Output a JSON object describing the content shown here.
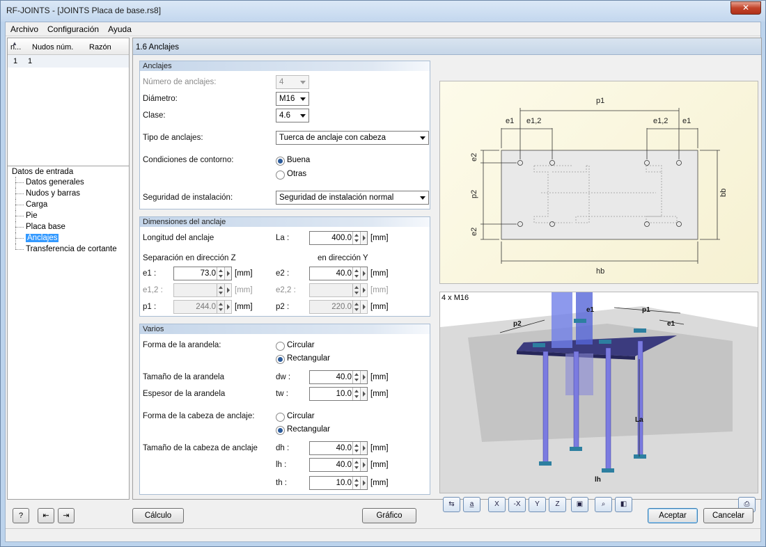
{
  "window": {
    "title": "RF-JOINTS - [JOINTS Placa de base.rs8]",
    "close_glyph": "✕"
  },
  "menu": [
    "Archivo",
    "Configuración",
    "Ayuda"
  ],
  "nav_table": {
    "headers": [
      "n...",
      "Nudos núm.",
      "Razón"
    ],
    "rows": [
      {
        "n": "1",
        "nudos": "1",
        "razon": ""
      }
    ]
  },
  "tree": {
    "root": "Datos de entrada",
    "items": [
      "Datos generales",
      "Nudos y barras",
      "Carga",
      "Pie",
      "Placa base",
      "Anclajes",
      "Transferencia de cortante"
    ],
    "selected": "Anclajes"
  },
  "main_title": "1.6 Anclajes",
  "anclajes": {
    "header": "Anclajes",
    "num_label": "Número de anclajes:",
    "num_value": "4",
    "diam_label": "Diámetro:",
    "diam_value": "M16",
    "clase_label": "Clase:",
    "clase_value": "4.6",
    "tipo_label": "Tipo de anclajes:",
    "tipo_value": "Tuerca de anclaje con cabeza",
    "cond_label": "Condiciones de contorno:",
    "cond_opt1": "Buena",
    "cond_opt2": "Otras",
    "seg_label": "Seguridad de instalación:",
    "seg_value": "Seguridad de instalación normal"
  },
  "dimensiones": {
    "header": "Dimensiones del anclaje",
    "long_label": "Longitud del anclaje",
    "la_sym": "La :",
    "la_value": "400.0",
    "sepz_label": "Separación en dirección Z",
    "sepy_label": "en dirección Y",
    "e1_sym": "e1 :",
    "e1_value": "73.0",
    "e12_sym": "e1,2 :",
    "e12_value": "",
    "p1_sym": "p1 :",
    "p1_value": "244.0",
    "e2_sym": "e2 :",
    "e2_value": "40.0",
    "e22_sym": "e2,2 :",
    "e22_value": "",
    "p2_sym": "p2 :",
    "p2_value": "220.0",
    "unit": "[mm]"
  },
  "varios": {
    "header": "Varios",
    "forma_arandela_label": "Forma de la arandela:",
    "opt_circular": "Circular",
    "opt_rect": "Rectangular",
    "tam_arandela_label": "Tamaño de la arandela",
    "dw_sym": "dw :",
    "dw_value": "40.0",
    "esp_arandela_label": "Espesor de la arandela",
    "tw_sym": "tw :",
    "tw_value": "10.0",
    "forma_cabeza_label": "Forma de la cabeza de anclaje:",
    "tam_cabeza_label": "Tamaño de la cabeza de anclaje",
    "dh_sym": "dh :",
    "dh_value": "40.0",
    "lh_sym": "lh :",
    "lh_value": "40.0",
    "th_sym": "th :",
    "th_value": "10.0",
    "unit": "[mm]"
  },
  "schematic": {
    "p1": "p1",
    "e1": "e1",
    "e12": "e1,2",
    "e2": "e2",
    "p2": "p2",
    "bb": "bb",
    "hb": "hb"
  },
  "view3d": {
    "caption": "4 x M16",
    "labels": {
      "e1": "e1",
      "p1": "p1",
      "p2": "p2",
      "e1b": "e1",
      "la": "La",
      "lh": "lh"
    }
  },
  "bottom": {
    "calculo": "Cálculo",
    "grafico": "Gráfico",
    "aceptar": "Aceptar",
    "cancelar": "Cancelar"
  }
}
